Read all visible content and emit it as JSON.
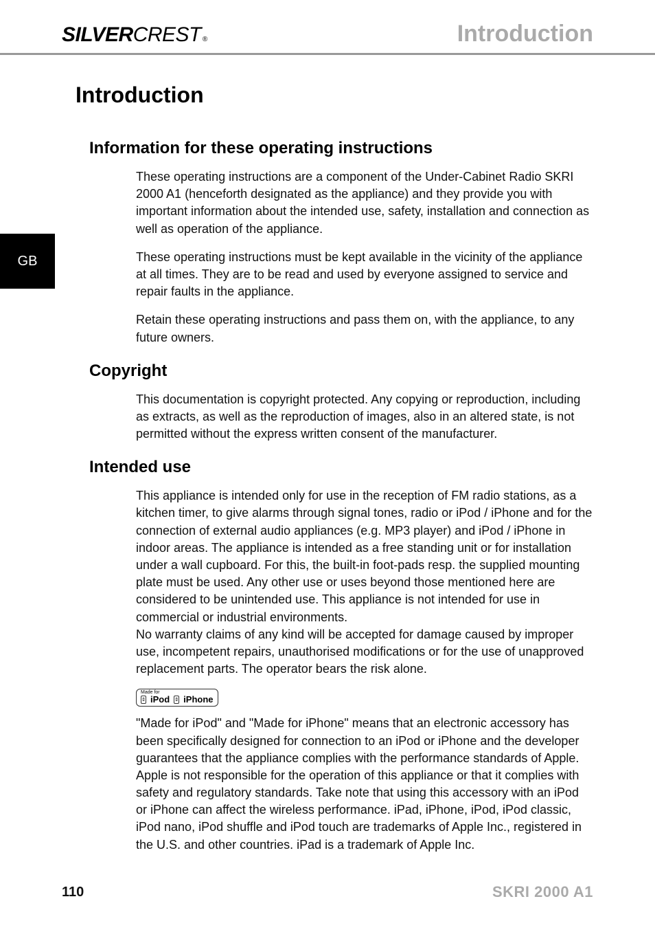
{
  "header": {
    "brand_part1": "SILVER",
    "brand_part2": "CREST",
    "brand_reg": "®",
    "page_title_top": "Introduction"
  },
  "sidebar": {
    "lang": "GB"
  },
  "content": {
    "main_heading": "Introduction",
    "sections": [
      {
        "heading": "Information for these operating instructions",
        "paragraphs": [
          "These operating instructions are a component of the Under-Cabinet Radio SKRI 2000 A1 (henceforth designated as the appliance) and they provide you with important information about the intended use, safety, installation and connection as well as operation of the appliance.",
          "These operating instructions must be kept available in the vicinity of the appliance at all times. They are to be read and used by everyone assigned to service and repair faults in the appliance.",
          "Retain these operating instructions and pass them on, with the appliance, to any future owners."
        ]
      },
      {
        "heading": "Copyright",
        "paragraphs": [
          "This documentation is copyright protected. Any copying or reproduction, including as extracts, as well as the reproduction of images, also in an altered state, is not permitted without the express written consent of the manufacturer."
        ]
      },
      {
        "heading": "Intended use",
        "paragraphs": [
          "This appliance is intended only for use in the reception of FM radio stations, as a kitchen timer, to give alarms through signal tones, radio or iPod / iPhone and for the connection of external audio appliances (e.g. MP3 player) and iPod / iPhone in indoor areas. The appliance is intended as a free standing unit or for installation under a wall cupboard. For this, the built-in foot-pads resp. the supplied mounting plate must be used. Any other use or uses beyond those mentioned here are considered to be unintended use. This appliance is not intended for use in commercial or industrial environments.\nNo warranty claims of any kind will be accepted for damage caused by improper use, incompetent repairs, unauthorised modifications or for the use of unapproved replacement parts. The operator bears the risk alone."
        ],
        "badge": {
          "top": "Made for",
          "item1": "iPod",
          "item2": "iPhone"
        },
        "after_badge": "\"Made for iPod\" and \"Made for iPhone\" means that an electronic accessory has been specifically designed for connection to an iPod or iPhone and the developer guarantees that the appliance complies with the performance standards of Apple. Apple is not responsible for the operation of this appliance or that it complies with safety and regulatory standards. Take note that using this accessory with an iPod or iPhone can affect the wireless performance. iPad, iPhone, iPod, iPod classic, iPod nano, iPod shuffle and iPod touch are trademarks of Apple Inc., registered in the U.S. and other countries. iPad is a trademark of Apple Inc."
      }
    ]
  },
  "footer": {
    "page_number": "110",
    "model": "SKRI 2000 A1"
  }
}
